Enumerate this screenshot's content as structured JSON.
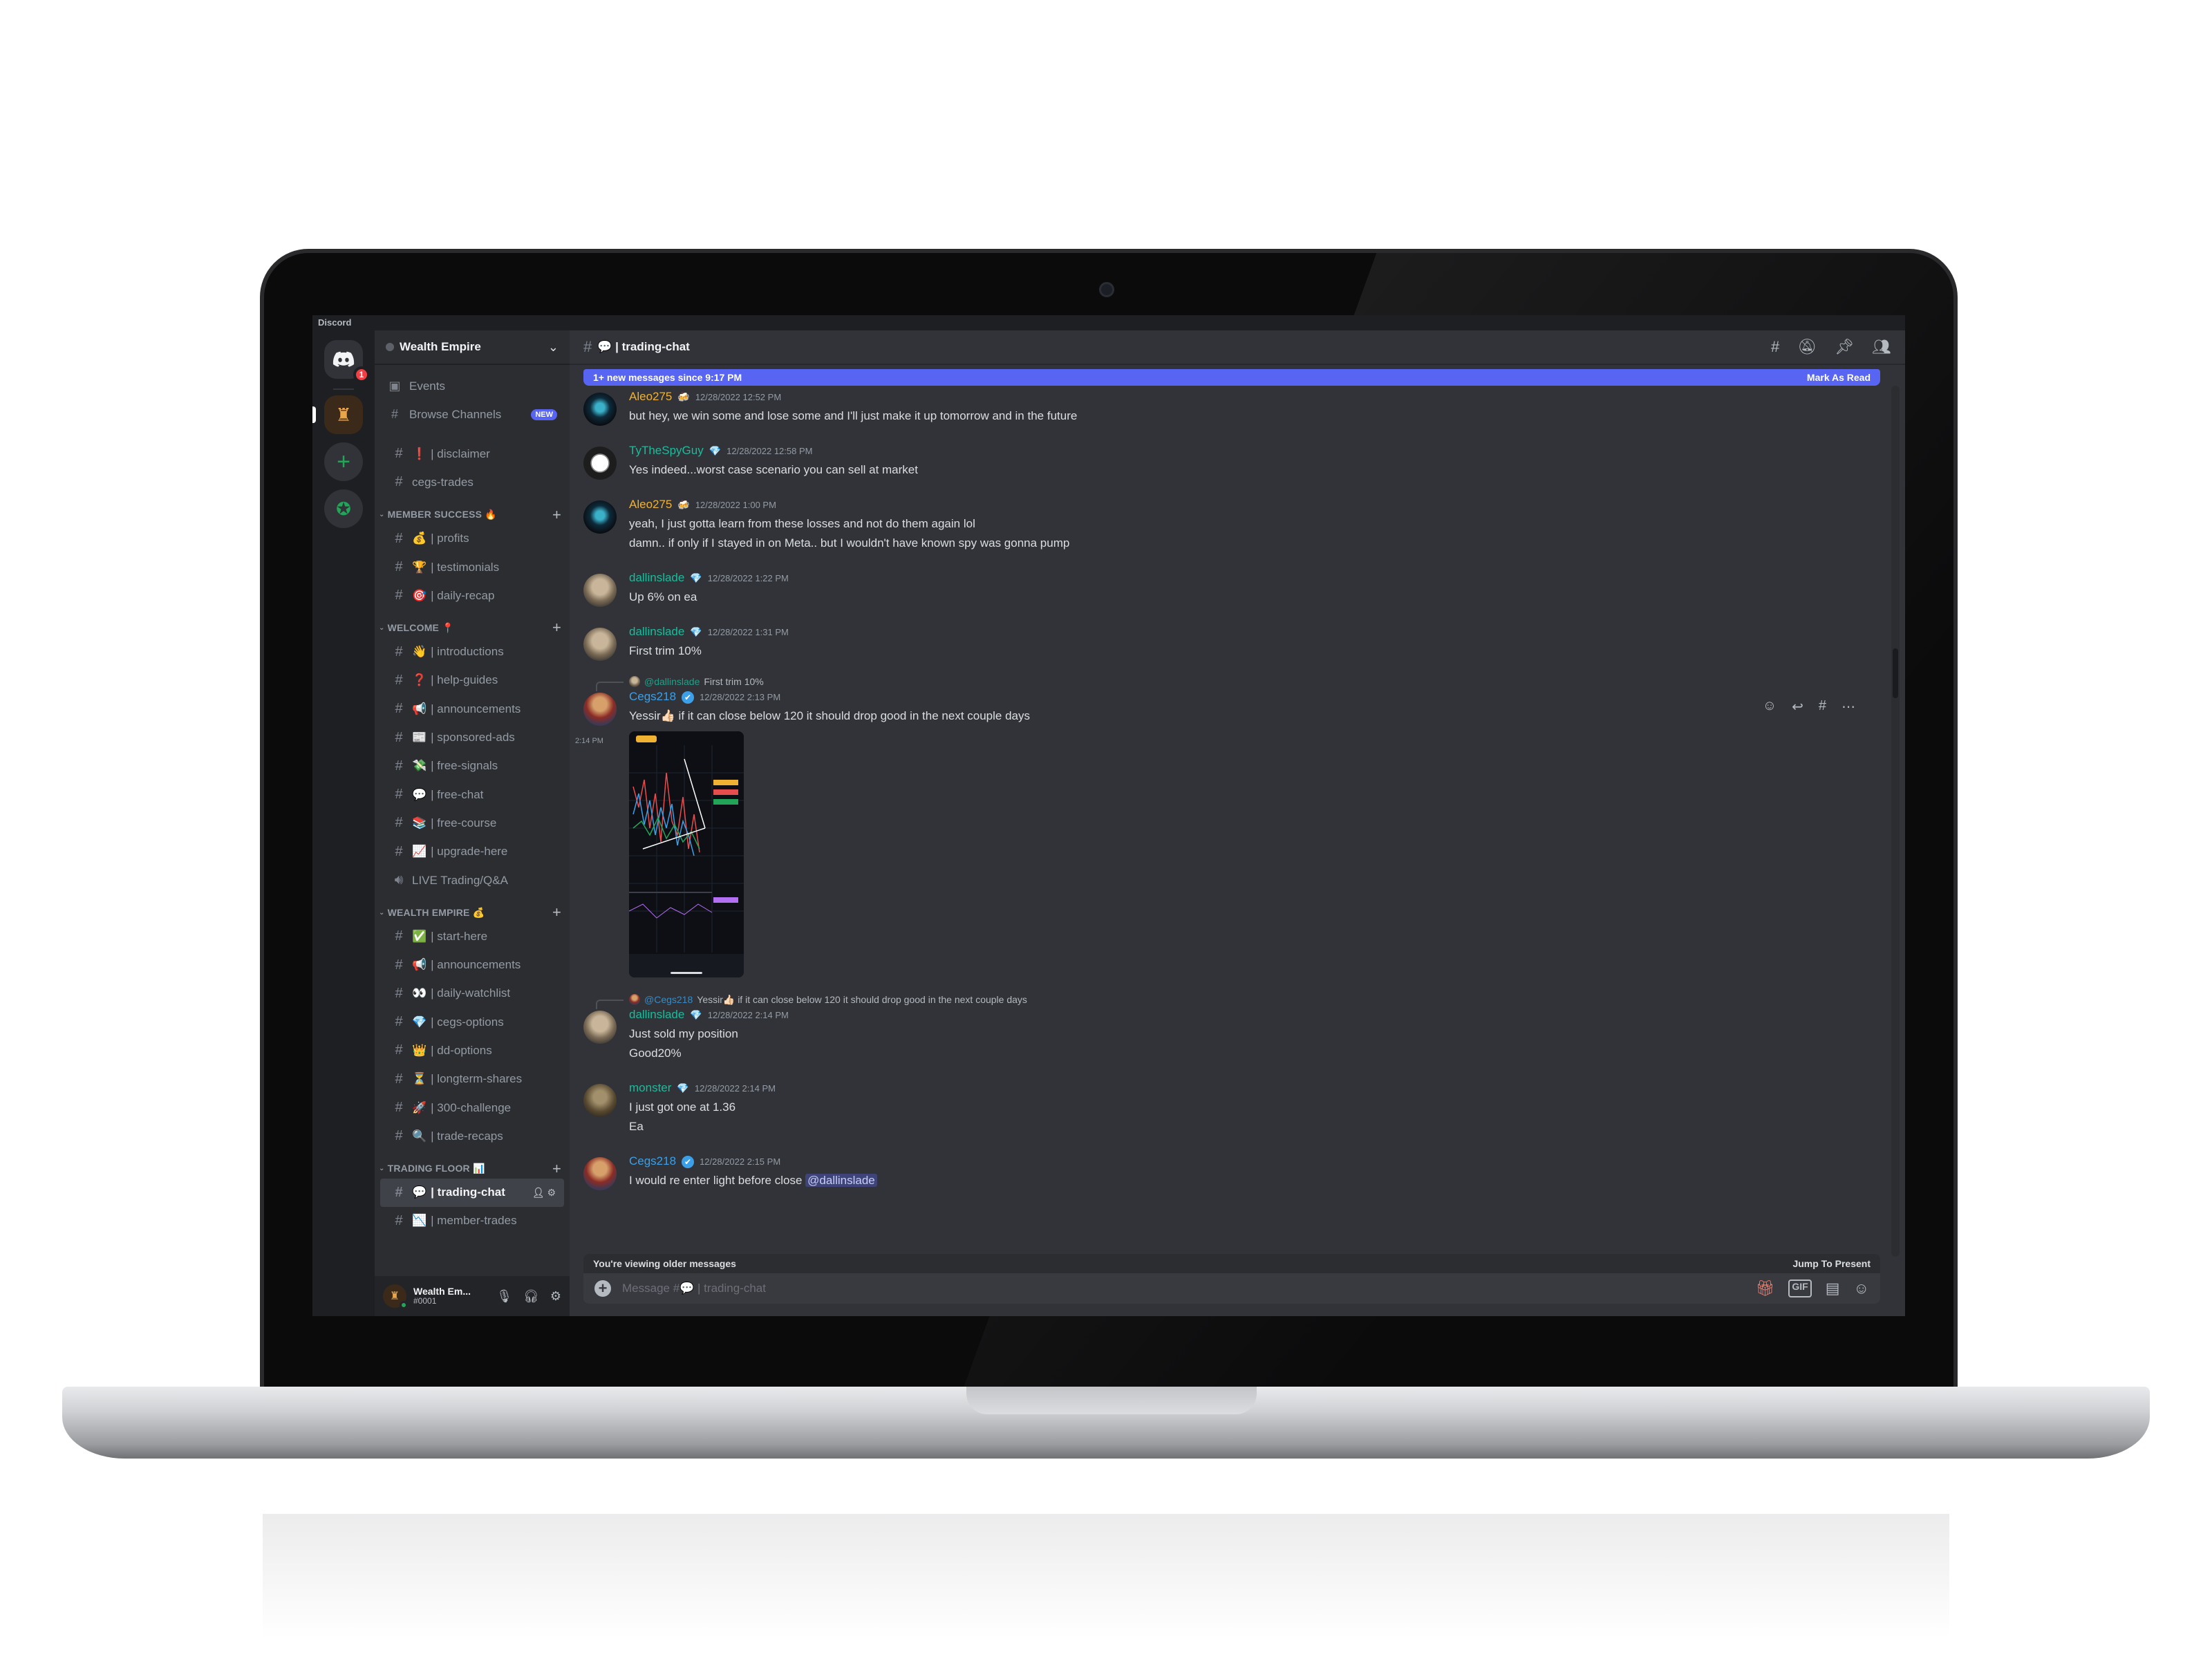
{
  "app": {
    "titlebar": "Discord"
  },
  "rail": {
    "badge": "1"
  },
  "guild": {
    "name": "Wealth Empire"
  },
  "nav": [
    {
      "label": "Events",
      "icon": "calendar-icon"
    },
    {
      "label": "Browse Channels",
      "icon": "browse-channels-icon",
      "badge": "NEW"
    }
  ],
  "top_channels": [
    {
      "label": "| disclaimer",
      "emoji": "❗"
    },
    {
      "label": "cegs-trades",
      "emoji": ""
    }
  ],
  "categories": [
    {
      "name": "MEMBER SUCCESS 🔥",
      "channels": [
        {
          "emoji": "💰",
          "label": "| profits"
        },
        {
          "emoji": "🏆",
          "label": "| testimonials"
        },
        {
          "emoji": "🎯",
          "label": "| daily-recap"
        }
      ]
    },
    {
      "name": "WELCOME 📍",
      "channels": [
        {
          "emoji": "👋",
          "label": "| introductions"
        },
        {
          "emoji": "❓",
          "label": "| help-guides"
        },
        {
          "emoji": "📢",
          "label": "| announcements"
        },
        {
          "emoji": "📰",
          "label": "| sponsored-ads"
        },
        {
          "emoji": "💸",
          "label": "| free-signals"
        },
        {
          "emoji": "💬",
          "label": "| free-chat"
        },
        {
          "emoji": "📚",
          "label": "| free-course"
        },
        {
          "emoji": "📈",
          "label": "| upgrade-here"
        },
        {
          "emoji": "",
          "label": "LIVE Trading/Q&A",
          "voice": true
        }
      ]
    },
    {
      "name": "WEALTH EMPIRE 💰",
      "channels": [
        {
          "emoji": "✅",
          "label": "| start-here"
        },
        {
          "emoji": "📢",
          "label": "| announcements"
        },
        {
          "emoji": "👀",
          "label": "| daily-watchlist"
        },
        {
          "emoji": "💎",
          "label": "| cegs-options"
        },
        {
          "emoji": "👑",
          "label": "| dd-options"
        },
        {
          "emoji": "⏳",
          "label": "| longterm-shares"
        },
        {
          "emoji": "🚀",
          "label": "| 300-challenge"
        },
        {
          "emoji": "🔍",
          "label": "| trade-recaps"
        }
      ]
    },
    {
      "name": "TRADING FLOOR 📊",
      "channels": [
        {
          "emoji": "💬",
          "label": "| trading-chat",
          "active": true
        },
        {
          "emoji": "📉",
          "label": "| member-trades"
        }
      ]
    }
  ],
  "user": {
    "name": "Wealth Em...",
    "tag": "#0001"
  },
  "chat": {
    "channel_title": "💬 | trading-chat",
    "new_messages": "1+ new messages since 9:17 PM",
    "mark_as_read": "Mark As Read",
    "older_notice": "You're viewing older messages",
    "jump_to_present": "Jump To Present",
    "composer_placeholder": "Message #💬 | trading-chat"
  },
  "messages": [
    {
      "author": "Aleo275",
      "color": "#f0b232",
      "badge": "🍻",
      "time": "12/28/2022 12:52 PM",
      "lines": [
        "but hey, we win some and lose some and I'll just make it up tomorrow and in the future"
      ]
    },
    {
      "author": "TyTheSpyGuy",
      "color": "#1abc9c",
      "badge": "💎",
      "time": "12/28/2022 12:58 PM",
      "lines": [
        "Yes indeed...worst case scenario you can sell at market"
      ]
    },
    {
      "author": "Aleo275",
      "color": "#f0b232",
      "badge": "🍻",
      "time": "12/28/2022 1:00 PM",
      "lines": [
        "yeah, I just gotta learn from these losses and not do them again lol",
        "damn.. if only if I stayed in on Meta.. but I wouldn't have known spy was gonna pump"
      ]
    },
    {
      "author": "dallinslade",
      "color": "#1abc9c",
      "badge": "💎",
      "time": "12/28/2022 1:22 PM",
      "lines": [
        "Up 6% on ea"
      ]
    },
    {
      "author": "dallinslade",
      "color": "#1abc9c",
      "badge": "💎",
      "time": "12/28/2022 1:31 PM",
      "lines": [
        "First trim 10%"
      ]
    },
    {
      "reply_to": "@dallinslade",
      "reply_text": "First trim 10%",
      "author": "Cegs218",
      "color": "#3ba0e8",
      "badge": "✔",
      "time": "12/28/2022 2:13 PM",
      "lines": [
        "Yessir👍🏻 if it can close below 120 it should drop good in the next couple days"
      ],
      "followup_time": "2:14 PM"
    },
    {
      "reply_to": "@Cegs218",
      "reply_text": "Yessir👍🏻 if it can close below 120 it should drop good in the next couple days",
      "author": "dallinslade",
      "color": "#1abc9c",
      "badge": "💎",
      "time": "12/28/2022 2:14 PM",
      "lines": [
        "Just sold my position",
        "Good20%"
      ]
    },
    {
      "author": "monster",
      "color": "#1abc9c",
      "badge": "💎",
      "time": "12/28/2022 2:14 PM",
      "lines": [
        "I just got one at 1.36",
        "Ea"
      ]
    },
    {
      "author": "Cegs218",
      "color": "#3ba0e8",
      "badge": "✔",
      "time": "12/28/2022 2:15 PM",
      "lines": [
        "I would re enter light before close"
      ],
      "mention": "@dallinslade"
    }
  ]
}
